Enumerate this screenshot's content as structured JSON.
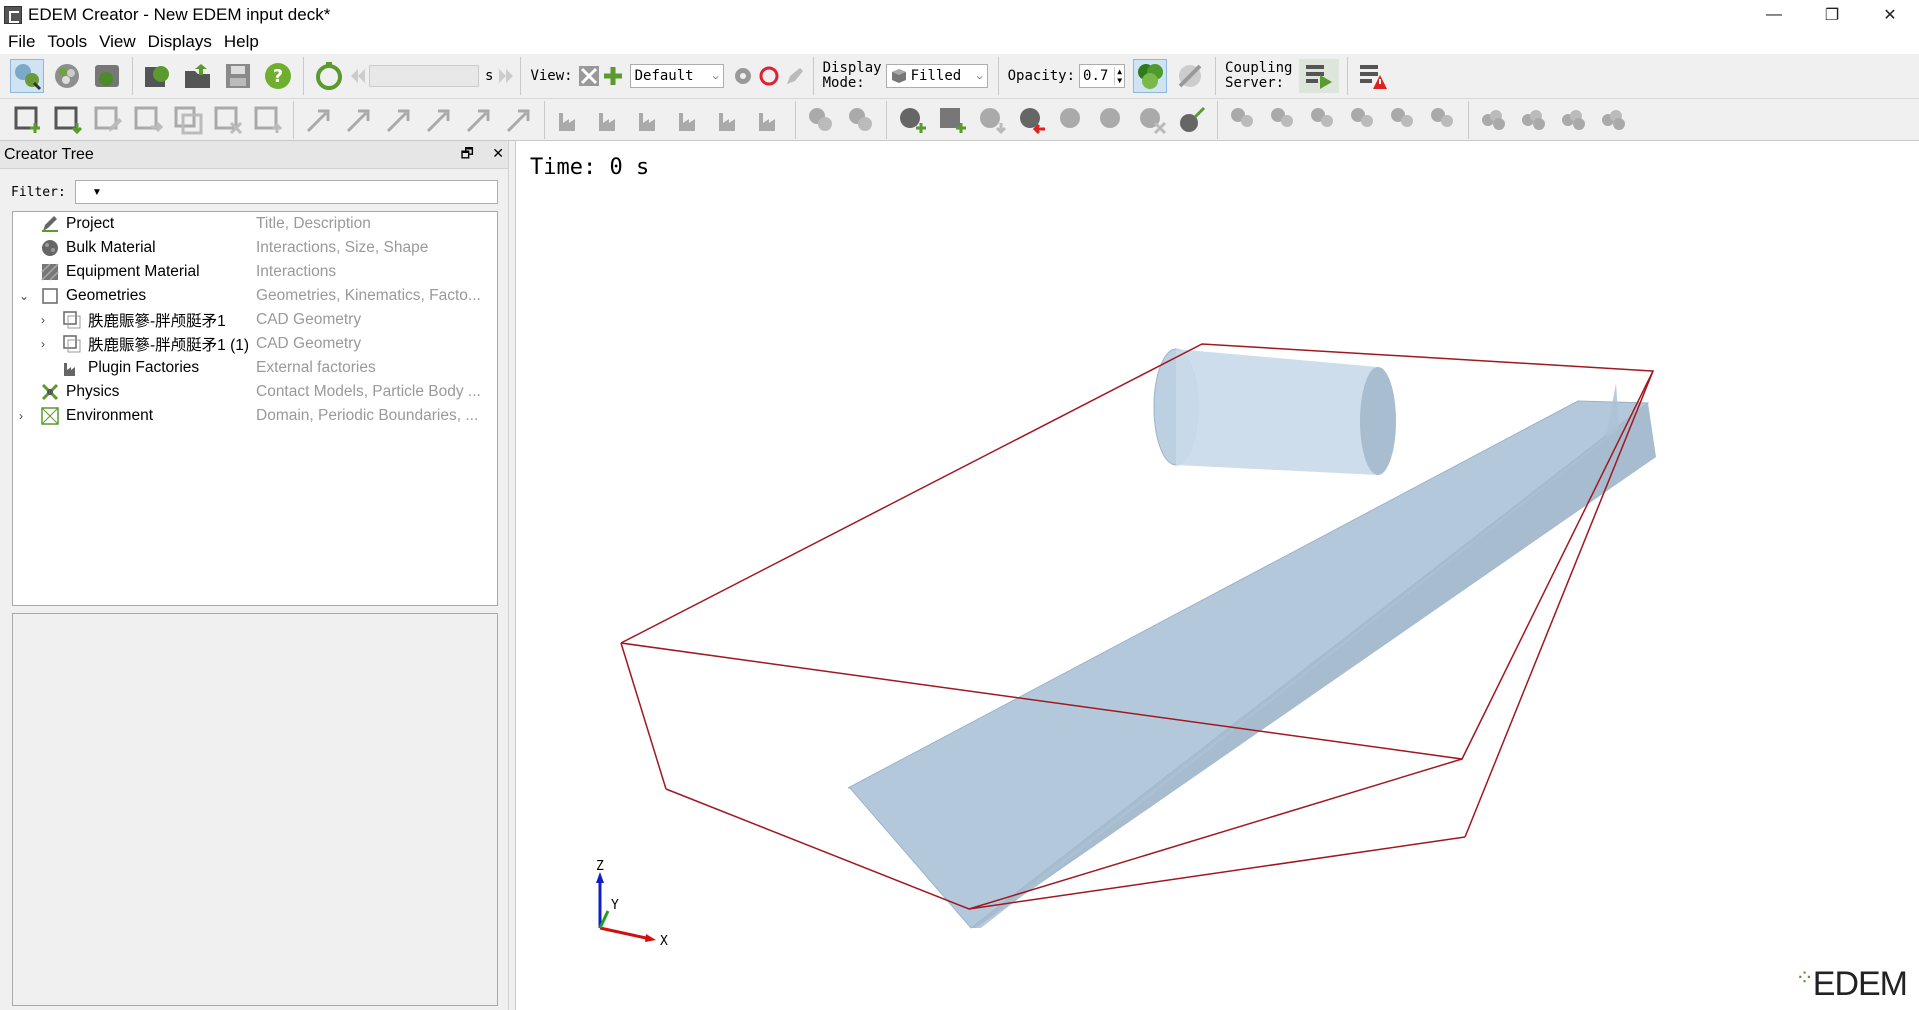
{
  "window": {
    "title": "EDEM Creator - New EDEM input deck*",
    "minimize": "—",
    "restore": "❐",
    "close": "✕"
  },
  "menu": [
    {
      "label": "File"
    },
    {
      "label": "Tools"
    },
    {
      "label": "View"
    },
    {
      "label": "Displays"
    },
    {
      "label": "Help"
    }
  ],
  "toolbar": {
    "time_unit": "s",
    "view_label": "View:",
    "view_value": "Default",
    "display_mode_label_1": "Display",
    "display_mode_label_2": "Mode:",
    "display_mode_value": "Filled",
    "opacity_label": "Opacity:",
    "opacity_value": "0.7",
    "coupling_label_1": "Coupling",
    "coupling_label_2": "Server:"
  },
  "panel": {
    "title": "Creator Tree",
    "filter_label": "Filter:"
  },
  "tree": [
    {
      "name": "Project",
      "desc": "Title, Description",
      "icon": "pencil-icon",
      "expander": ""
    },
    {
      "name": "Bulk Material",
      "desc": "Interactions, Size, Shape",
      "icon": "bulk-material-icon",
      "expander": ""
    },
    {
      "name": "Equipment Material",
      "desc": "Interactions",
      "icon": "equipment-material-icon",
      "expander": ""
    },
    {
      "name": "Geometries",
      "desc": "Geometries, Kinematics, Facto...",
      "icon": "geometry-icon",
      "expander": "v"
    },
    {
      "name": "胅鹿賑篸-胖颅脡矛1",
      "desc": "CAD Geometry",
      "icon": "cad-geometry-icon",
      "expander": ">"
    },
    {
      "name": "胅鹿賑篸-胖颅脡矛1 (1)",
      "desc": "CAD Geometry",
      "icon": "cad-geometry-icon",
      "expander": ">"
    },
    {
      "name": "Plugin Factories",
      "desc": "External factories",
      "icon": "factory-icon",
      "expander": ""
    },
    {
      "name": "Physics",
      "desc": "Contact Models, Particle Body ...",
      "icon": "physics-icon",
      "expander": ""
    },
    {
      "name": "Environment",
      "desc": "Domain, Periodic Boundaries, ...",
      "icon": "environment-icon",
      "expander": ">"
    }
  ],
  "viewport": {
    "time_label": "Time: 0 s",
    "axis_x": "X",
    "axis_y": "Y",
    "axis_z": "Z",
    "logo": "EDEM"
  }
}
